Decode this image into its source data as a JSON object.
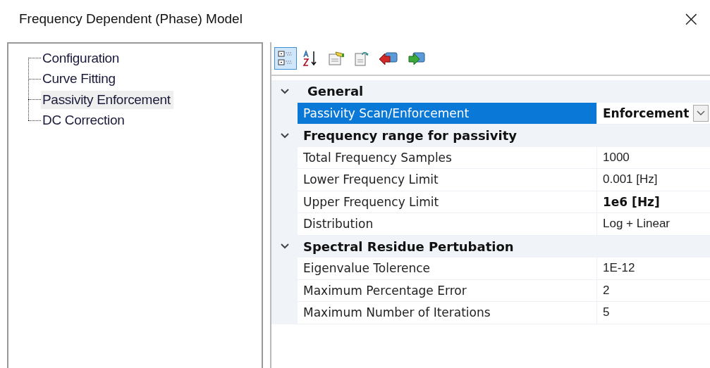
{
  "window": {
    "title": "Frequency Dependent (Phase) Model",
    "close": "×"
  },
  "tree": {
    "items": [
      {
        "label": "Configuration",
        "selected": false
      },
      {
        "label": "Curve Fitting",
        "selected": false
      },
      {
        "label": "Passivity Enforcement",
        "selected": true
      },
      {
        "label": "DC Correction",
        "selected": false
      }
    ]
  },
  "toolbar": [
    {
      "kind": "categorized",
      "selected": true
    },
    {
      "kind": "alphabetical",
      "selected": false
    },
    {
      "kind": "pages",
      "selected": false
    },
    {
      "kind": "export",
      "selected": false
    },
    {
      "kind": "back",
      "selected": false
    },
    {
      "kind": "forward",
      "selected": false
    }
  ],
  "categories": [
    {
      "name": "General",
      "expanded": true,
      "properties": [
        {
          "name": "Passivity Scan/Enforcement",
          "value": "Enforcement",
          "bold": true,
          "selected": true,
          "kind": "dropdown"
        }
      ]
    },
    {
      "name": "Frequency range for passivity",
      "expanded": true,
      "properties": [
        {
          "name": "Total Frequency Samples",
          "value": "1000",
          "bold": false,
          "selected": false,
          "kind": "text"
        },
        {
          "name": "Lower Frequency Limit",
          "value": "0.001 [Hz]",
          "bold": false,
          "selected": false,
          "kind": "text"
        },
        {
          "name": "Upper Frequency Limit",
          "value": "1e6 [Hz]",
          "bold": true,
          "selected": false,
          "kind": "text"
        },
        {
          "name": "Distribution",
          "value": "Log + Linear",
          "bold": false,
          "selected": false,
          "kind": "text"
        }
      ]
    },
    {
      "name": "Spectral Residue Pertubation",
      "expanded": true,
      "properties": [
        {
          "name": "Eigenvalue Tolerence",
          "value": "1E-12",
          "bold": false,
          "selected": false,
          "kind": "text"
        },
        {
          "name": "Maximum Percentage Error",
          "value": "2",
          "bold": false,
          "selected": false,
          "kind": "text"
        },
        {
          "name": "Maximum Number of Iterations",
          "value": "5",
          "bold": false,
          "selected": false,
          "kind": "text"
        }
      ]
    }
  ]
}
